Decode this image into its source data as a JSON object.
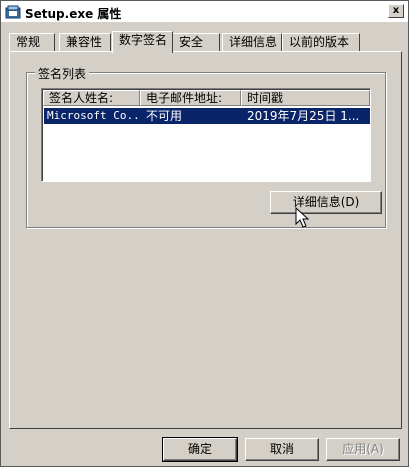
{
  "window": {
    "title": "Setup.exe 属性",
    "close_label": "x"
  },
  "tabs": [
    {
      "label": "常规",
      "active": false
    },
    {
      "label": "兼容性",
      "active": false
    },
    {
      "label": "数字签名",
      "active": true
    },
    {
      "label": "安全",
      "active": false
    },
    {
      "label": "详细信息",
      "active": false
    },
    {
      "label": "以前的版本",
      "active": false
    }
  ],
  "signature_group": {
    "label": "签名列表",
    "columns": [
      "签名人姓名:",
      "电子邮件地址:",
      "时间戳"
    ],
    "rows": [
      {
        "signer": "Microsoft Co...",
        "email": "不可用",
        "timestamp": "2019年7月25日 1...",
        "selected": true
      }
    ],
    "details_button": "详细信息(D)"
  },
  "footer": {
    "ok": "确定",
    "cancel": "取消",
    "apply": "应用(A)"
  },
  "icons": {
    "title": "setup-app-icon",
    "cursor": "mouse-pointer-icon"
  },
  "colors": {
    "selection": "#0a246a",
    "face": "#d4d0c8"
  }
}
